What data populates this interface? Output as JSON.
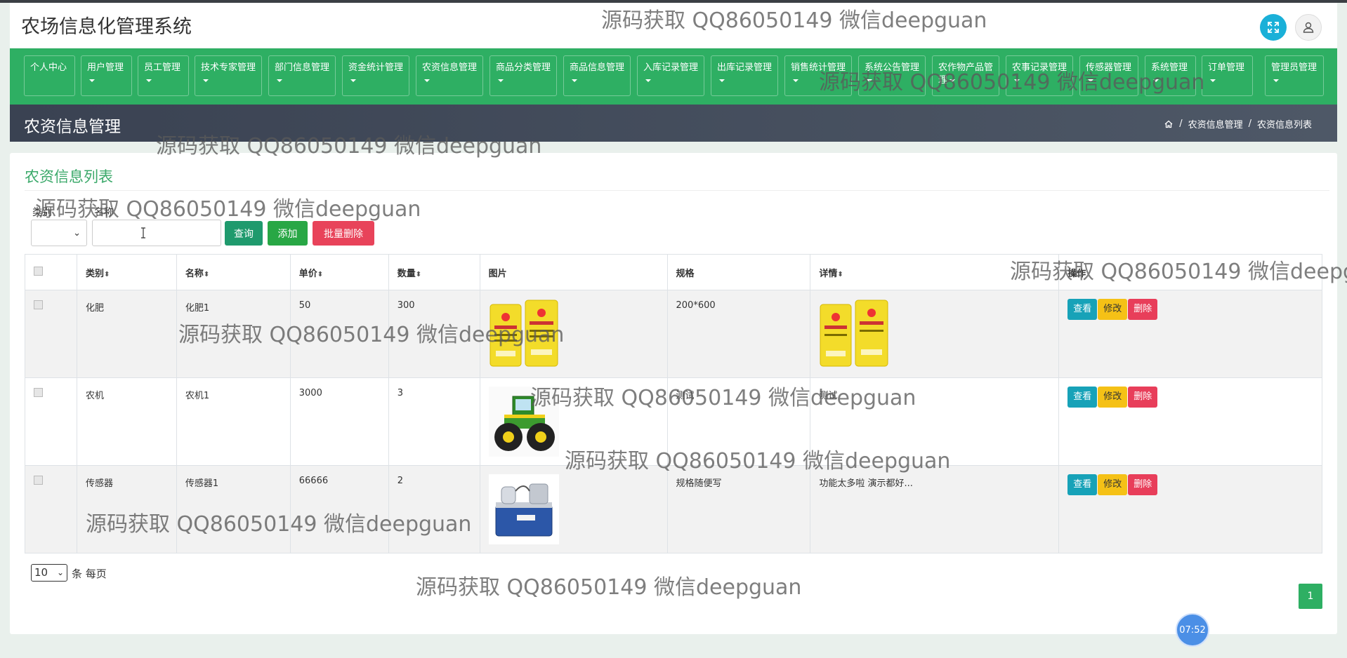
{
  "app": {
    "title": "农场信息化管理系统"
  },
  "nav": {
    "items": [
      {
        "label": "个人中心",
        "has_caret": false
      },
      {
        "label": "用户管理",
        "has_caret": true
      },
      {
        "label": "员工管理",
        "has_caret": true
      },
      {
        "label": "技术专家管理",
        "has_caret": true
      },
      {
        "label": "部门信息管理",
        "has_caret": true
      },
      {
        "label": "资金统计管理",
        "has_caret": true
      },
      {
        "label": "农资信息管理",
        "has_caret": true
      },
      {
        "label": "商品分类管理",
        "has_caret": true
      },
      {
        "label": "商品信息管理",
        "has_caret": true
      },
      {
        "label": "入库记录管理",
        "has_caret": true
      },
      {
        "label": "出库记录管理",
        "has_caret": true
      },
      {
        "label": "销售统计管理",
        "has_caret": true
      },
      {
        "label": "系统公告管理",
        "has_caret": true
      },
      {
        "label": "农作物产品管理",
        "has_caret": true
      },
      {
        "label": "农事记录管理",
        "has_caret": true
      },
      {
        "label": "传感器管理",
        "has_caret": true
      },
      {
        "label": "系统管理",
        "has_caret": true
      },
      {
        "label": "订单管理",
        "has_caret": true
      },
      {
        "label": "管理员管理",
        "has_caret": true
      }
    ]
  },
  "page": {
    "title": "农资信息管理"
  },
  "breadcrumb": {
    "sep": "/",
    "items": [
      "农资信息管理",
      "农资信息列表"
    ]
  },
  "card": {
    "title": "农资信息列表"
  },
  "search": {
    "category_label": "类别",
    "name_label": "名称",
    "category_value": "",
    "name_value": "",
    "query_btn": "查询",
    "add_btn": "添加",
    "batch_delete_btn": "批量删除"
  },
  "table": {
    "headers": [
      "类别",
      "名称",
      "单价",
      "数量",
      "图片",
      "规格",
      "详情",
      "操作"
    ],
    "rows": [
      {
        "category": "化肥",
        "name": "化肥1",
        "price": "50",
        "qty": "300",
        "spec": "200*600",
        "detail": "",
        "image": "fertilizer-bags"
      },
      {
        "category": "农机",
        "name": "农机1",
        "price": "3000",
        "qty": "3",
        "spec": "测试",
        "detail": "测试",
        "image": "tractor"
      },
      {
        "category": "传感器",
        "name": "传感器1",
        "price": "66666",
        "qty": "2",
        "spec": "规格随便写",
        "detail": "功能太多啦 演示都好...",
        "image": "sensor-device"
      }
    ],
    "actions": {
      "view": "查看",
      "edit": "修改",
      "delete": "删除"
    }
  },
  "pager": {
    "page_size": "10",
    "per_page_label": "条 每页",
    "current_page": "1"
  },
  "clock": {
    "time": "07:52"
  },
  "watermark": {
    "text": "源码获取 QQ86050149 微信deepguan"
  },
  "colors": {
    "primary": "#2eaf63",
    "info": "#17a2b8",
    "warning": "#f5c116",
    "danger": "#e83e5a",
    "subheader": "#3a4252"
  }
}
